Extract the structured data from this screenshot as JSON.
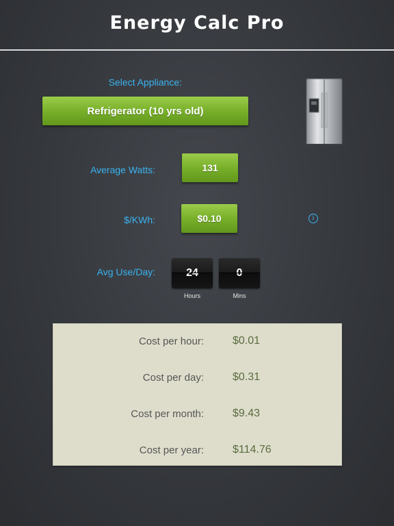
{
  "app": {
    "title": "Energy Calc Pro"
  },
  "appliance": {
    "label": "Select Appliance:",
    "selected": "Refrigerator (10 yrs old)",
    "image_icon": "refrigerator-icon"
  },
  "watts": {
    "label": "Average Watts:",
    "value": "131"
  },
  "rate": {
    "label": "$/KWh:",
    "value": "$0.10",
    "info_icon": "info-icon"
  },
  "usage": {
    "label": "Avg Use/Day:",
    "hours": "24",
    "hours_caption": "Hours",
    "mins": "0",
    "mins_caption": "Mins"
  },
  "costs": [
    {
      "label": "Cost per hour:",
      "value": "$0.01"
    },
    {
      "label": "Cost per day:",
      "value": "$0.31"
    },
    {
      "label": "Cost per month:",
      "value": "$9.43"
    },
    {
      "label": "Cost per year:",
      "value": "$114.76"
    }
  ],
  "colors": {
    "accent_blue": "#3ab3f0",
    "button_green": "#78b02a",
    "value_green": "#5a6b3e",
    "panel": "#deddcc"
  }
}
